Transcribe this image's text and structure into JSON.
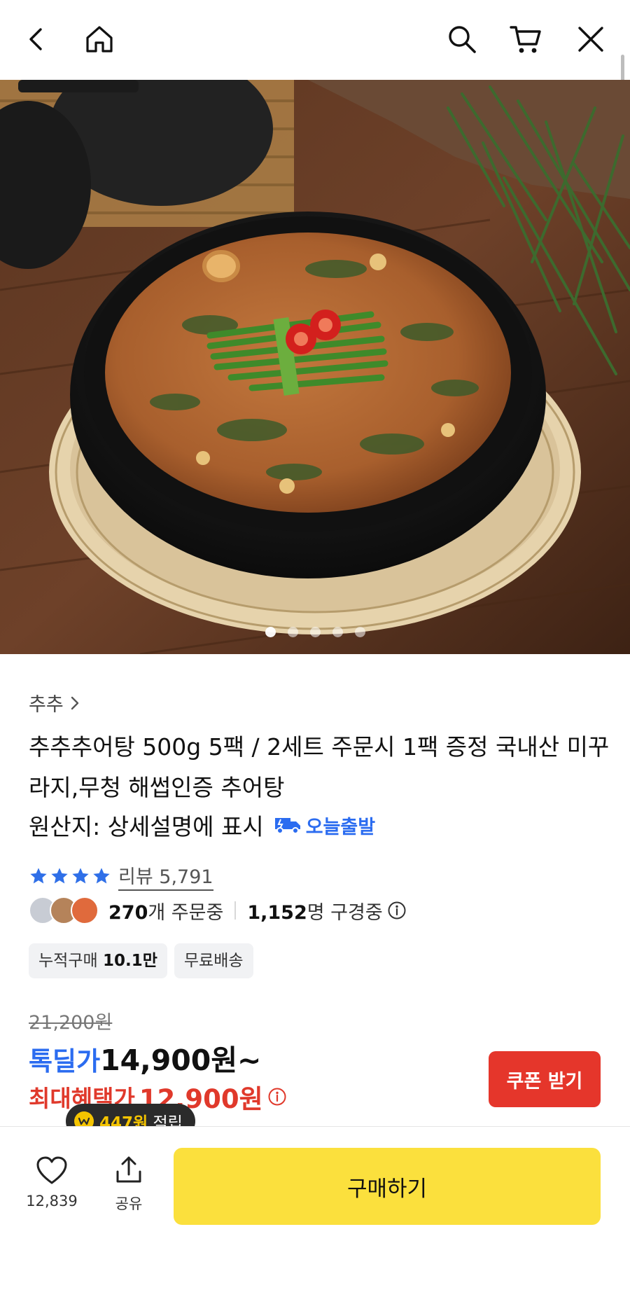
{
  "brand": {
    "name": "추추",
    "chevron_icon": "chevron-right-icon"
  },
  "product": {
    "title": "추추추어탕 500g 5팩 / 2세트 주문시 1팩 증정 국내산 미꾸라지,무청 해썹인증 추어탕",
    "origin": "원산지: 상세설명에 표시",
    "delivery_badge": "오늘출발"
  },
  "reviews": {
    "stars": 4,
    "label": "리뷰 5,791"
  },
  "activity": {
    "ordering_num": "270",
    "ordering_suffix": "개 주문중",
    "viewing_num": "1,152",
    "viewing_suffix": "명 구경중"
  },
  "tags": {
    "cumulative_label": "누적구매",
    "cumulative_value": "10.1만",
    "free_shipping": "무료배송"
  },
  "price": {
    "original": "21,200원",
    "deal_label": "톡딜가",
    "deal_price": "14,900원~",
    "max_label": "최대혜택가",
    "max_price": "12,900원"
  },
  "coupon": {
    "label": "쿠폰 받기"
  },
  "points": {
    "amount": "447원",
    "suffix": "적립"
  },
  "bottom": {
    "like_count": "12,839",
    "share_label": "공유",
    "buy_label": "구매하기"
  },
  "carousel": {
    "total": 5,
    "active_index": 0
  },
  "colors": {
    "accent_blue": "#2b6cf0",
    "sale_red": "#e0392b",
    "coupon_red": "#e5362b",
    "buy_yellow": "#fbe03d",
    "star_blue": "#2f6fe8"
  },
  "icons": [
    "back-icon",
    "home-icon",
    "search-icon",
    "cart-icon",
    "close-icon",
    "heart-icon",
    "share-icon",
    "info-icon",
    "truck-icon",
    "coin-icon",
    "star-icon"
  ]
}
